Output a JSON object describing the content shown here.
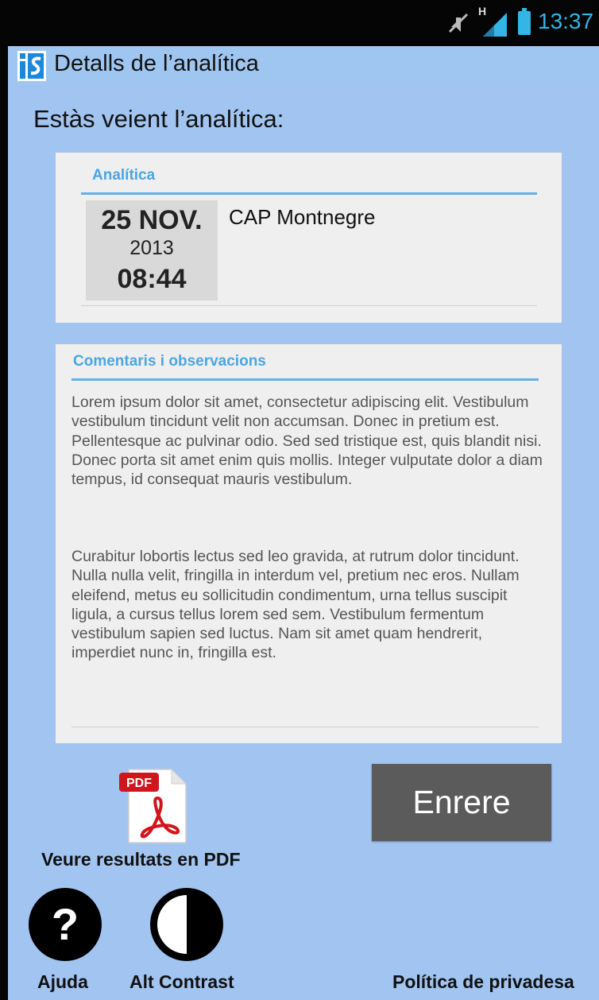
{
  "status_bar": {
    "time": "13:37",
    "network_label": "H",
    "icons": [
      "mute-icon",
      "signal-icon",
      "battery-icon"
    ]
  },
  "action_bar": {
    "title": "Detalls de l’analítica",
    "logo": "app-logo-icon"
  },
  "page": {
    "heading": "Estàs veient l’analítica:"
  },
  "analysis_card": {
    "title": "Analítica",
    "date_day": "25 NOV.",
    "date_year": "2013",
    "time": "08:44",
    "place": "CAP Montnegre"
  },
  "comments_card": {
    "title": "Comentaris i observacions",
    "paragraphs": [
      "Lorem ipsum dolor sit amet, consectetur adipiscing elit. Vestibulum vestibulum tincidunt velit non accumsan. Donec in pretium est. Pellentesque ac pulvinar odio. Sed sed tristique est, quis blandit nisi. Donec porta sit amet enim quis mollis. Integer vulputate dolor a diam tempus, id consequat mauris vestibulum.",
      "Curabitur lobortis lectus sed leo gravida, at rutrum dolor tincidunt. Nulla nulla velit, fringilla in interdum vel, pretium nec eros. Nullam eleifend, metus eu sollicitudin condimentum, urna tellus suscipit ligula, a cursus tellus lorem sed sem. Vestibulum fermentum vestibulum sapien sed luctus. Nam sit amet quam hendrerit, imperdiet nunc in, fringilla est."
    ]
  },
  "actions": {
    "pdf_label": "Veure resultats en PDF",
    "pdf_badge": "PDF",
    "back_label": "Enrere"
  },
  "footer": {
    "help_label": "Ajuda",
    "help_glyph": "?",
    "contrast_label": "Alt Contrast",
    "privacy_label": "Política de privadesa"
  },
  "colors": {
    "background": "#a2c4f0",
    "accent": "#4aa6e3",
    "button": "#5b5b5b",
    "status_accent": "#33b5e5"
  }
}
